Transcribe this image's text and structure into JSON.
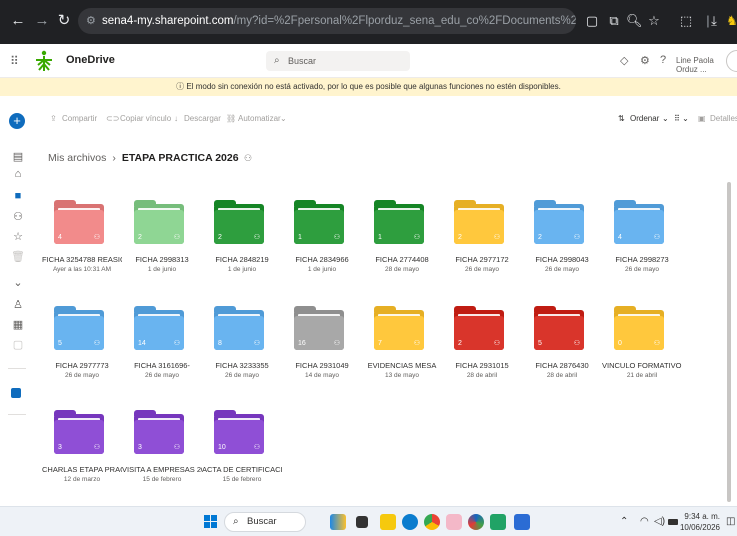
{
  "browser": {
    "url_host": "sena4-my.sharepoint.com",
    "url_path": "/my?id=%2Fpersonal%2Flporduz_sena_edu_co%2FDocuments%2FETAPA%20PRACTICA%202026&viewi..."
  },
  "header": {
    "app_name": "OneDrive",
    "search_placeholder": "Buscar",
    "user_name": "Line Paola Orduz ..."
  },
  "notice": {
    "text": "El modo sin conexión no está activado, por lo que es posible que algunas funciones no estén disponibles."
  },
  "commands": {
    "share": "Compartir",
    "copy_link": "Copiar vínculo",
    "download": "Descargar",
    "automate": "Automatizar",
    "sort": "Ordenar",
    "details": "Detalles"
  },
  "breadcrumb": {
    "root": "Mis archivos",
    "current": "ETAPA PRACTICA 2026"
  },
  "colors": {
    "pink": "#f28b8b",
    "lightgreen": "#8fd694",
    "green": "#2e9e3e",
    "yellow": "#ffc83d",
    "lightblue": "#69b4f0",
    "gray": "#a8a8a8",
    "red": "#d9352b",
    "purple": "#8f4fd6"
  },
  "folders": [
    {
      "name": "FICHA 3254788 REASIG...",
      "date": "Ayer a las 10:31 AM",
      "count": "4",
      "color": "pink"
    },
    {
      "name": "FICHA 2998313",
      "date": "1 de junio",
      "count": "2",
      "color": "lightgreen"
    },
    {
      "name": "FICHA 2848219",
      "date": "1 de junio",
      "count": "2",
      "color": "green"
    },
    {
      "name": "FICHA 2834966",
      "date": "1 de junio",
      "count": "1",
      "color": "green"
    },
    {
      "name": "FICHA 2774408",
      "date": "28 de mayo",
      "count": "1",
      "color": "green"
    },
    {
      "name": "FICHA 2977172",
      "date": "26 de mayo",
      "count": "2",
      "color": "yellow"
    },
    {
      "name": "FICHA 2998043",
      "date": "26 de mayo",
      "count": "2",
      "color": "lightblue"
    },
    {
      "name": "FICHA 2998273",
      "date": "26 de mayo",
      "count": "4",
      "color": "lightblue"
    },
    {
      "name": "FICHA 2977773",
      "date": "26 de mayo",
      "count": "5",
      "color": "lightblue"
    },
    {
      "name": "FICHA 3161696-",
      "date": "26 de mayo",
      "count": "14",
      "color": "lightblue"
    },
    {
      "name": "FICHA 3233355",
      "date": "26 de mayo",
      "count": "8",
      "color": "lightblue"
    },
    {
      "name": "FICHA 2931049",
      "date": "14 de mayo",
      "count": "16",
      "color": "gray"
    },
    {
      "name": "EVIDENCIAS MESA",
      "date": "13 de mayo",
      "count": "7",
      "color": "yellow"
    },
    {
      "name": "FICHA 2931015",
      "date": "28 de abril",
      "count": "2",
      "color": "red"
    },
    {
      "name": "FICHA 2876430",
      "date": "28 de abril",
      "count": "5",
      "color": "red"
    },
    {
      "name": "VINCULO FORMATIVO ...",
      "date": "21 de abril",
      "count": "0",
      "color": "yellow"
    },
    {
      "name": "CHARLAS ETAPA PRACT...",
      "date": "12 de marzo",
      "count": "3",
      "color": "purple"
    },
    {
      "name": "VISITA A EMPRESAS 2026",
      "date": "15 de febrero",
      "count": "3",
      "color": "purple"
    },
    {
      "name": "ACTA DE CERTIFICACIO...",
      "date": "15 de febrero",
      "count": "10",
      "color": "purple"
    }
  ],
  "taskbar": {
    "search_label": "Buscar",
    "time": "9:34 a. m.",
    "date": "10/06/2026"
  }
}
